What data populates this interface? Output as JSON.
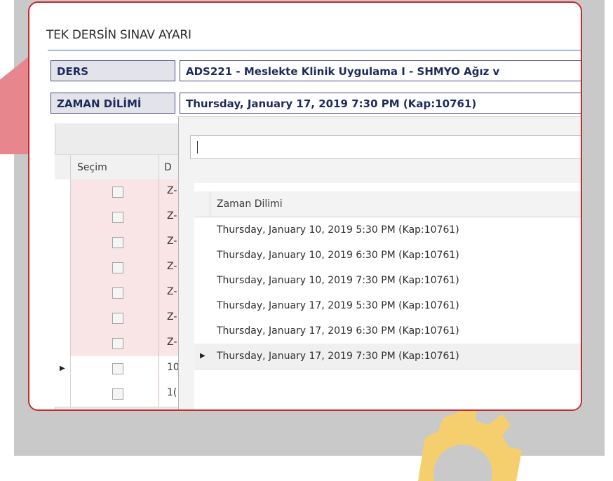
{
  "window": {
    "title": "TEK DERSİN SINAV AYARI"
  },
  "fields": {
    "ders": {
      "label": "DERS",
      "value": "ADS221 - Meslekte Klinik Uygulama I - SHMYO Ağız v"
    },
    "zaman": {
      "label": "ZAMAN DİLİMİ",
      "value": "Thursday, January 17, 2019 7:30 PM (Kap:10761)"
    }
  },
  "grid": {
    "headers": {
      "selection": "Seçim",
      "col2": "D"
    },
    "rows": [
      {
        "col2": "Z-",
        "checked": false,
        "current": false
      },
      {
        "col2": "Z-",
        "checked": false,
        "current": false
      },
      {
        "col2": "Z-",
        "checked": false,
        "current": false
      },
      {
        "col2": "Z-",
        "checked": false,
        "current": false
      },
      {
        "col2": "Z-",
        "checked": false,
        "current": false
      },
      {
        "col2": "Z-",
        "checked": false,
        "current": false
      },
      {
        "col2": "Z-",
        "checked": false,
        "current": false
      },
      {
        "col2": "10",
        "checked": false,
        "current": true
      },
      {
        "col2": "1(",
        "checked": false,
        "current": false
      }
    ]
  },
  "popup": {
    "search": {
      "value": ""
    },
    "column_header": "Zaman Dilimi",
    "rows": [
      {
        "label": "Thursday, January 10, 2019 5:30 PM (Kap:10761)",
        "selected": false
      },
      {
        "label": "Thursday, January 10, 2019 6:30 PM (Kap:10761)",
        "selected": false
      },
      {
        "label": "Thursday, January 10, 2019 7:30 PM (Kap:10761)",
        "selected": false
      },
      {
        "label": "Thursday, January 17, 2019 5:30 PM (Kap:10761)",
        "selected": false
      },
      {
        "label": "Thursday, January 17, 2019 6:30 PM (Kap:10761)",
        "selected": false
      },
      {
        "label": "Thursday, January 17, 2019 7:30 PM (Kap:10761)",
        "selected": true
      }
    ]
  },
  "icons": {
    "row_pointer": "row-pointer-icon",
    "gear": "gear-icon"
  },
  "colors": {
    "frame_border": "#c8292e",
    "gear": "#f5cf6e",
    "row_tint": "#f9e4e6"
  }
}
